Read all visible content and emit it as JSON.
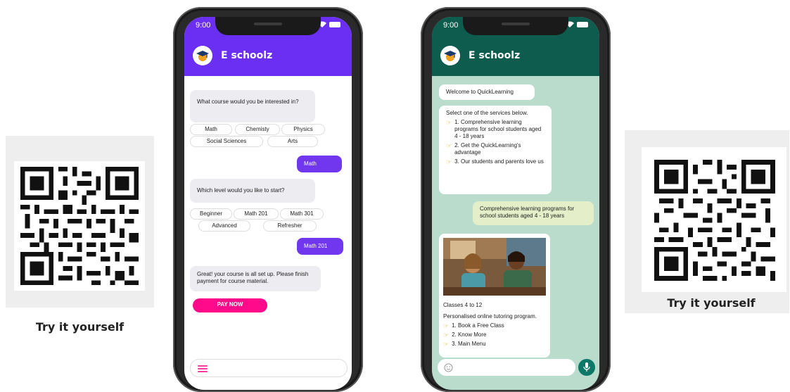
{
  "qr_left": {
    "caption": "Try it yourself"
  },
  "qr_right": {
    "caption": "Try it yourself"
  },
  "phone1": {
    "time": "9:00",
    "title": "E schoolz",
    "accent": "#6a2ff2",
    "q1": "What course would you be interested in?",
    "courses": [
      "Math",
      "Chemisty",
      "Physics",
      "Social Sciences",
      "Arts"
    ],
    "reply1": "Math",
    "q2": "Which level would you like to start?",
    "levels": [
      "Beginner",
      "Math 201",
      "Math 301",
      "Advanced",
      "Refresher"
    ],
    "reply2": "Math 201",
    "msg3": "Great! your course is all set up. Please finish payment for course material.",
    "pay_label": "PAY NOW",
    "pay_color": "#ff0a8a"
  },
  "phone2": {
    "time": "9:00",
    "title": "E schoolz",
    "accent": "#0d5c4e",
    "bg": "#b9dccd",
    "welcome": "Welcome to QuickLearning",
    "select_intro": "Select one of the services below.",
    "services": [
      "1. Comprehensive learning programs for school students aged 4 - 18 years",
      "2. Get the QuickLearning's advantage",
      "3. Our students and parents love us"
    ],
    "reply": "Comprehensive learning programs for school students aged 4 - 18 years",
    "classes": "Classes 4 to 12",
    "tutoring": "Personalised online tutoring program.",
    "options": [
      "1. Book a Free Class",
      "2. Know More",
      "3. Main Menu"
    ]
  }
}
